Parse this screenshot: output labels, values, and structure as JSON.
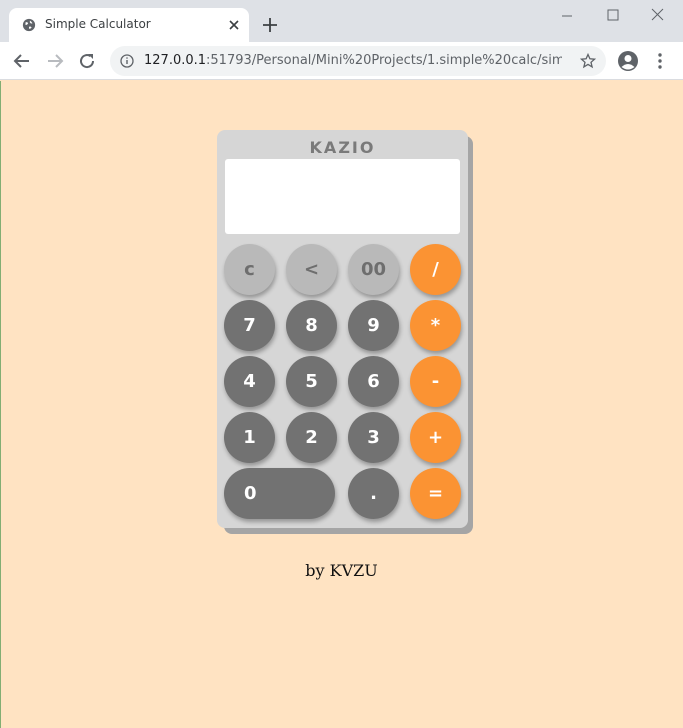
{
  "browser": {
    "tab_title": "Simple Calculator",
    "url_host": "127.0.0.1",
    "url_rest": ":51793/Personal/Mini%20Projects/1.simple%20calc/simpl..."
  },
  "calculator": {
    "brand": "KAZIO",
    "display_value": "",
    "keys": {
      "clear": "c",
      "backspace": "<",
      "double_zero": "00",
      "divide": "/",
      "seven": "7",
      "eight": "8",
      "nine": "9",
      "multiply": "*",
      "four": "4",
      "five": "5",
      "six": "6",
      "subtract": "-",
      "one": "1",
      "two": "2",
      "three": "3",
      "add": "+",
      "zero": "0",
      "decimal": ".",
      "equals": "="
    }
  },
  "footer": {
    "credit": "by KVZU"
  },
  "colors": {
    "page_background": "#ffe3c2",
    "calculator_body": "#d6d6d6",
    "function_key": "#b9b9b9",
    "number_key": "#727272",
    "operator_key": "#fb9333"
  },
  "icons": {
    "tab_favicon": "globe-icon",
    "tab_close": "close-icon",
    "new_tab": "plus-icon",
    "back": "arrow-left-icon",
    "forward": "arrow-right-icon",
    "reload": "reload-icon",
    "site_info": "info-icon",
    "bookmark": "star-icon",
    "profile": "account-icon",
    "menu": "more-vertical-icon"
  }
}
